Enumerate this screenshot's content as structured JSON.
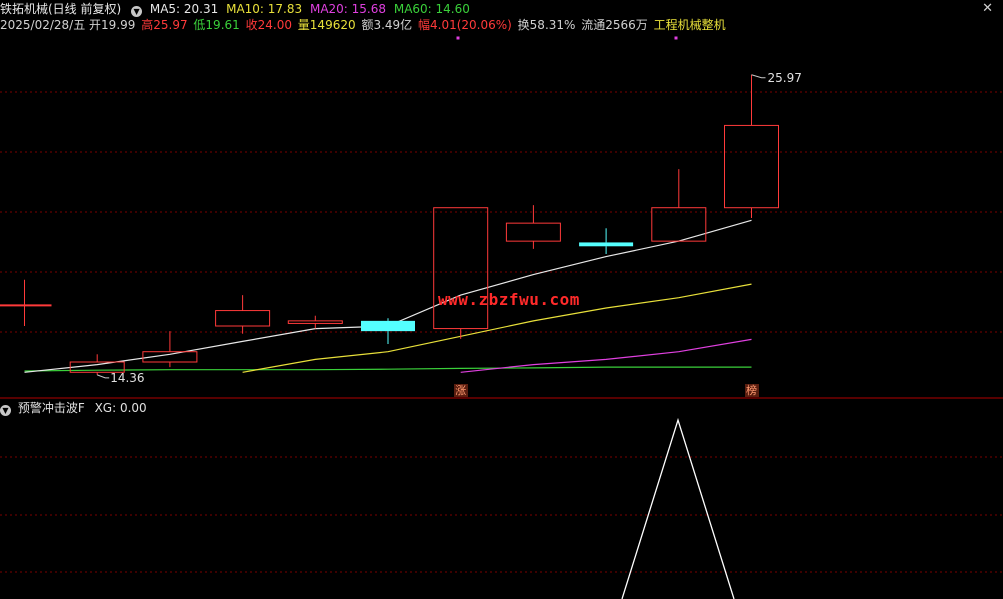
{
  "header": {
    "stock_title": "铁拓机械(日线 前复权)",
    "ma5": "MA5: 20.31",
    "ma10": "MA10: 17.83",
    "ma20": "MA20: 15.68",
    "ma60": "MA60: 14.60",
    "date": "2025/02/28/五",
    "open": "开19.99",
    "high": "高25.97",
    "low": "低19.61",
    "close": "收24.00",
    "volume": "量149620",
    "amount": "额3.49亿",
    "change": "幅4.01(20.06%)",
    "turnover": "换58.31%",
    "float": "流通2566万",
    "industry": "工程机械整机",
    "close_icon": "x-icon"
  },
  "colors": {
    "up": "#ff3a3a",
    "down": "#54ffff",
    "ma5": "#e8e8e8",
    "ma10": "#e8e03a",
    "ma20": "#e040e0",
    "ma60": "#3ad03a",
    "grid": "#7a0000",
    "indicator": "#ffffff",
    "industry": "#e8e03a"
  },
  "chart_data": {
    "type": "candlestick",
    "ylim": [
      13.4,
      27.4
    ],
    "candles": [
      {
        "open": 17.0,
        "close": 17.0,
        "high": 18.0,
        "low": 16.2
      },
      {
        "open": 14.4,
        "close": 14.8,
        "high": 15.1,
        "low": 14.3
      },
      {
        "open": 14.8,
        "close": 15.2,
        "high": 16.0,
        "low": 14.6
      },
      {
        "open": 16.2,
        "close": 16.8,
        "high": 17.4,
        "low": 15.9
      },
      {
        "open": 16.3,
        "close": 16.4,
        "high": 16.6,
        "low": 16.1
      },
      {
        "open": 16.4,
        "close": 16.0,
        "high": 16.5,
        "low": 15.5
      },
      {
        "open": 16.1,
        "close": 20.8,
        "high": 20.8,
        "low": 15.7
      },
      {
        "open": 19.5,
        "close": 20.2,
        "high": 20.9,
        "low": 19.2
      },
      {
        "open": 19.45,
        "close": 19.3,
        "high": 20.0,
        "low": 19.0
      },
      {
        "open": 19.5,
        "close": 20.8,
        "high": 22.3,
        "low": 19.5
      },
      {
        "open": 20.8,
        "close": 24.0,
        "high": 25.97,
        "low": 20.4
      }
    ],
    "ma5": [
      14.4,
      14.7,
      15.1,
      15.6,
      16.1,
      16.2,
      17.4,
      18.2,
      18.9,
      19.5,
      20.31
    ],
    "ma10": [
      null,
      null,
      null,
      14.4,
      14.9,
      15.2,
      15.8,
      16.4,
      16.9,
      17.3,
      17.83
    ],
    "ma20": [
      null,
      null,
      null,
      null,
      null,
      null,
      14.4,
      14.7,
      14.9,
      15.2,
      15.68
    ],
    "ma60": [
      14.45,
      14.48,
      14.5,
      14.5,
      14.5,
      14.52,
      14.55,
      14.57,
      14.6,
      14.6,
      14.6
    ],
    "high_label": "25.97",
    "low_label": "14.36",
    "signal_tags": [
      {
        "index": 6,
        "text": "涨"
      },
      {
        "index": 10,
        "text": "榜"
      }
    ],
    "indicator": {
      "name": "预警冲击波F",
      "value_label": "XG: 0.00",
      "values": [
        0,
        0,
        0,
        0,
        0,
        0,
        0,
        0,
        0,
        1,
        0
      ]
    }
  },
  "watermark": "www.zbzfwu.com"
}
